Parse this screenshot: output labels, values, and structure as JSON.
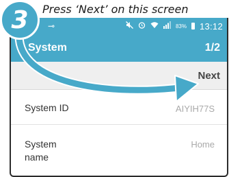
{
  "instruction": {
    "step_number": "3",
    "text": "Press ‘Next’ on this screen"
  },
  "status_bar": {
    "key_icon": "key-icon",
    "battery_percent": "83%",
    "time": "13:12",
    "icons": [
      "mute-icon",
      "alarm-icon",
      "wifi-icon",
      "signal-icon",
      "battery-icon"
    ]
  },
  "app_bar": {
    "back_label": "System",
    "page_counter": "1/2"
  },
  "toolbar": {
    "next_label": "Next"
  },
  "rows": [
    {
      "label": "System ID",
      "value": "AIYIH77S"
    },
    {
      "label": "System name",
      "value": "Home"
    }
  ],
  "colors": {
    "accent": "#47a9c9",
    "next_bar": "#efefef",
    "arrow": "#47a9c9"
  }
}
